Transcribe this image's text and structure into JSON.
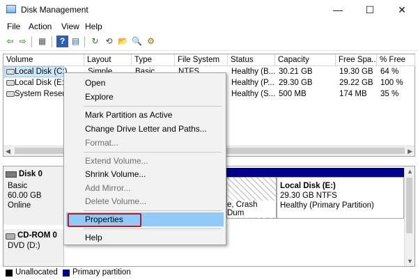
{
  "window": {
    "title": "Disk Management",
    "minimize_glyph": "—",
    "maximize_glyph": "☐",
    "close_glyph": "✕"
  },
  "menu": [
    "File",
    "Action",
    "View",
    "Help"
  ],
  "toolbar": {
    "icons": [
      "back-icon",
      "forward-icon",
      "console-tree-icon",
      "help-icon",
      "help-topics-icon",
      "refresh-icon",
      "rescan-icon",
      "open-icon",
      "properties-icon",
      "settings-icon"
    ],
    "glyphs": [
      "⇦",
      "⇨",
      "▦",
      "?",
      "▤",
      "↻",
      "⟲",
      "📂",
      "🔍",
      "⚙"
    ]
  },
  "volume_table": {
    "headers": [
      "Volume",
      "Layout",
      "Type",
      "File System",
      "Status",
      "Capacity",
      "Free Spa...",
      "% Free"
    ],
    "rows": [
      [
        "Local Disk (C:)",
        "Simple",
        "Basic",
        "NTFS",
        "Healthy (B...",
        "30.21 GB",
        "19.30 GB",
        "64 %"
      ],
      [
        "Local Disk (E:)",
        "",
        "",
        "",
        "Healthy (P...",
        "29.30 GB",
        "29.22 GB",
        "100 %"
      ],
      [
        "System Reserve",
        "",
        "",
        "",
        "Healthy (S...",
        "500 MB",
        "174 MB",
        "35 %"
      ]
    ]
  },
  "disks": {
    "disk0": {
      "name": "Disk 0",
      "type": "Basic",
      "size": "60.00 GB",
      "status": "Online"
    },
    "cdrom": {
      "name": "CD-ROM 0",
      "drive": "DVD (D:)"
    },
    "hatched_partition_text": "e, Crash Dum",
    "partition_e": {
      "name": "Local Disk  (E:)",
      "size": "29.30 GB NTFS",
      "status": "Healthy (Primary Partition)"
    }
  },
  "legend": [
    {
      "label": "Unallocated",
      "color": "#000000"
    },
    {
      "label": "Primary partition",
      "color": "#00008b"
    }
  ],
  "context_menu": {
    "items": [
      {
        "label": "Open",
        "enabled": true
      },
      {
        "label": "Explore",
        "enabled": true
      },
      {
        "label": "Mark Partition as Active",
        "enabled": true
      },
      {
        "label": "Change Drive Letter and Paths...",
        "enabled": true
      },
      {
        "label": "Format...",
        "enabled": false
      },
      {
        "label": "Extend Volume...",
        "enabled": false
      },
      {
        "label": "Shrink Volume...",
        "enabled": true
      },
      {
        "label": "Add Mirror...",
        "enabled": false
      },
      {
        "label": "Delete Volume...",
        "enabled": false
      },
      {
        "label": "Properties",
        "enabled": true,
        "highlighted": true
      },
      {
        "label": "Help",
        "enabled": true
      }
    ]
  },
  "colors": {
    "highlight": "#91c9f7",
    "selection_row": "#cce8ff",
    "partition_bar": "#00008b",
    "callout": "#b71c2c"
  }
}
